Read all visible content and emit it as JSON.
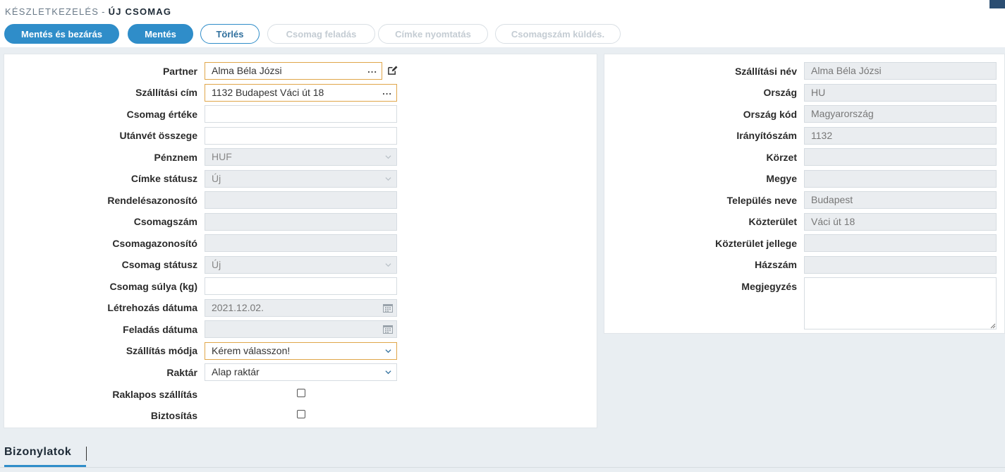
{
  "breadcrumb": {
    "module": "Készletkezelés",
    "separator": "-",
    "page": "Új csomag"
  },
  "toolbar": {
    "save_close": "Mentés és bezárás",
    "save": "Mentés",
    "delete": "Törlés",
    "send_package": "Csomag feladás",
    "print_label": "Címke nyomtatás",
    "send_package_number": "Csomagszám küldés."
  },
  "left_form": {
    "partner": {
      "label": "Partner",
      "value": "Alma Béla Józsi",
      "action": "..."
    },
    "shipping_address": {
      "label": "Szállítási cím",
      "value": "1132 Budapest Váci út 18",
      "action": "..."
    },
    "package_value": {
      "label": "Csomag értéke",
      "value": ""
    },
    "cod_amount": {
      "label": "Utánvét összege",
      "value": ""
    },
    "currency": {
      "label": "Pénznem",
      "value": "HUF"
    },
    "label_status": {
      "label": "Címke státusz",
      "value": "Új"
    },
    "order_id": {
      "label": "Rendelésazonosító",
      "value": ""
    },
    "package_number": {
      "label": "Csomagszám",
      "value": ""
    },
    "package_id": {
      "label": "Csomagazonosító",
      "value": ""
    },
    "package_status": {
      "label": "Csomag státusz",
      "value": "Új"
    },
    "package_weight": {
      "label": "Csomag súlya (kg)",
      "value": ""
    },
    "created_date": {
      "label": "Létrehozás dátuma",
      "value": "2021.12.02."
    },
    "dispatch_date": {
      "label": "Feladás dátuma",
      "value": ""
    },
    "shipping_method": {
      "label": "Szállítás módja",
      "value": "Kérem válasszon!"
    },
    "warehouse": {
      "label": "Raktár",
      "value": "Alap raktár"
    },
    "pallet_shipping": {
      "label": "Raklapos szállítás",
      "checked": false
    },
    "insurance": {
      "label": "Biztosítás",
      "checked": false
    }
  },
  "right_form": {
    "shipping_name": {
      "label": "Szállítási név",
      "value": "Alma Béla Józsi"
    },
    "country": {
      "label": "Ország",
      "value": "HU"
    },
    "country_code": {
      "label": "Ország kód",
      "value": "Magyarország"
    },
    "postal_code": {
      "label": "Irányítószám",
      "value": "1132"
    },
    "district": {
      "label": "Körzet",
      "value": ""
    },
    "county": {
      "label": "Megye",
      "value": ""
    },
    "city": {
      "label": "Település neve",
      "value": "Budapest"
    },
    "street": {
      "label": "Közterület",
      "value": "Váci út 18"
    },
    "street_type": {
      "label": "Közterület jellege",
      "value": ""
    },
    "house_number": {
      "label": "Házszám",
      "value": ""
    },
    "note": {
      "label": "Megjegyzés",
      "value": ""
    }
  },
  "tabs": {
    "documents": "Bizonylatok"
  },
  "colors": {
    "accent": "#2f8dc9",
    "highlight_border": "#e0a64a",
    "readonly_bg": "#eaedf0",
    "page_bg": "#e9eef2"
  },
  "icons": {
    "edit": "edit-icon",
    "calendar": "calendar-icon",
    "chevron": "chevron-down-icon"
  }
}
